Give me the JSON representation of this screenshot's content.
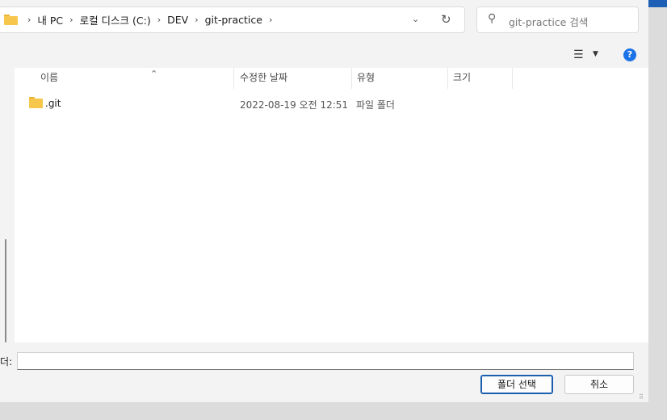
{
  "address_bar": {
    "breadcrumbs": [
      "내 PC",
      "로컬 디스크 (C:)",
      "DEV",
      "git-practice"
    ]
  },
  "search": {
    "placeholder": "git-practice 검색"
  },
  "columns": {
    "name": "이름",
    "modified": "수정한 날짜",
    "type": "유형",
    "size": "크기"
  },
  "files": [
    {
      "name": ".git",
      "modified": "2022-08-19 오전 12:51",
      "type": "파일 폴더",
      "size": ""
    }
  ],
  "footer": {
    "folder_label": "더:",
    "folder_value": "",
    "select_label": "폴더 선택",
    "cancel_label": "취소"
  },
  "icons": {
    "refresh": "refresh-icon",
    "search": "search-icon",
    "view": "view-options-icon",
    "help": "help-icon"
  },
  "colors": {
    "accent": "#1a73e8",
    "folder": "#f6c74a"
  }
}
